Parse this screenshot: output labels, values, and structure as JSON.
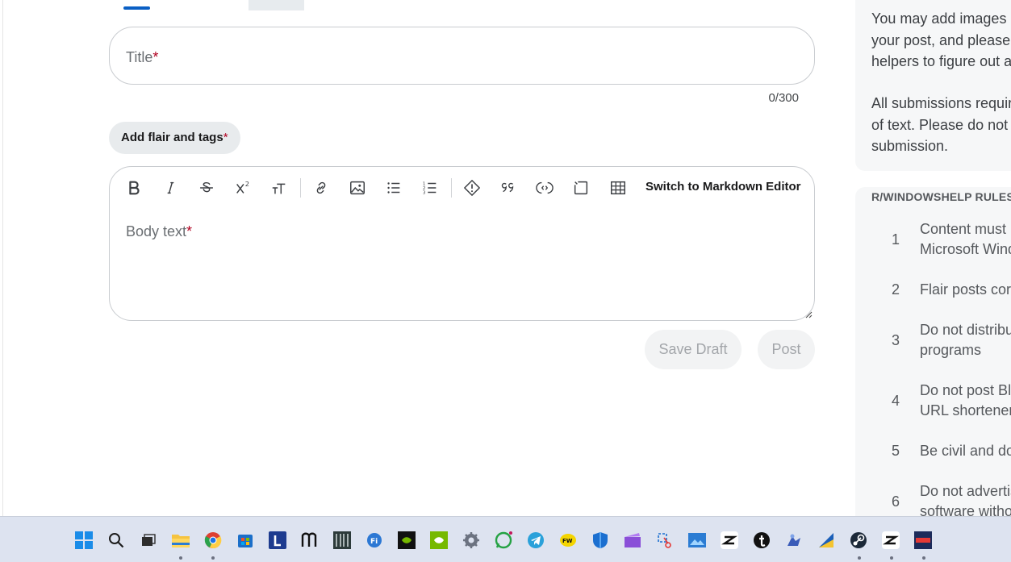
{
  "form": {
    "title_placeholder": "Title",
    "required_mark": "*",
    "char_count": "0/300",
    "flair_label": "Add flair and tags",
    "body_placeholder": "Body text",
    "switch_editor_label": "Switch to Markdown Editor",
    "save_draft_label": "Save Draft",
    "post_label": "Post",
    "toolbar_icons": [
      "bold-icon",
      "italic-icon",
      "strikethrough-icon",
      "superscript-icon",
      "heading-icon",
      "link-icon",
      "image-icon",
      "bullet-list-icon",
      "numbered-list-icon",
      "spoiler-icon",
      "quote-icon",
      "code-icon",
      "code-block-icon",
      "table-icon"
    ]
  },
  "sidebar": {
    "guideline_lines": [
      "You may add images o",
      "your post, and please d",
      "helpers to figure out a",
      "",
      "All submissions require",
      "of text. Please do not a",
      "submission."
    ],
    "rules_title": "R/WINDOWSHELP RULES",
    "rules": [
      {
        "num": "1",
        "lines": [
          "Content must b",
          "Microsoft Wind"
        ]
      },
      {
        "num": "2",
        "lines": [
          "Flair posts corr"
        ]
      },
      {
        "num": "3",
        "lines": [
          "Do not distribu",
          "programs"
        ]
      },
      {
        "num": "4",
        "lines": [
          "Do not post Bl",
          "URL shorteners"
        ]
      },
      {
        "num": "5",
        "lines": [
          "Be civil and do"
        ]
      },
      {
        "num": "6",
        "lines": [
          "Do not advertis",
          "software witho"
        ]
      }
    ]
  },
  "taskbar": {
    "apps": [
      "windows-start",
      "search",
      "task-view",
      "file-explorer",
      "chrome",
      "microsoft-store",
      "l-app",
      "notion",
      "pinball-app",
      "settings-app-blue",
      "nvidia",
      "nvidia-alt",
      "settings-gear",
      "whatsapp",
      "telegram",
      "fw-app",
      "defender",
      "clapper-app",
      "snipping-tool",
      "photos-app",
      "capcut",
      "tumblr",
      "wordpad-app",
      "kite-app",
      "steam",
      "capcut-alt",
      "ms-app"
    ]
  },
  "colors": {
    "accent_blue": "#0a5fc4",
    "required_red": "#b00020",
    "taskbar_bg": "#dde3f0"
  }
}
